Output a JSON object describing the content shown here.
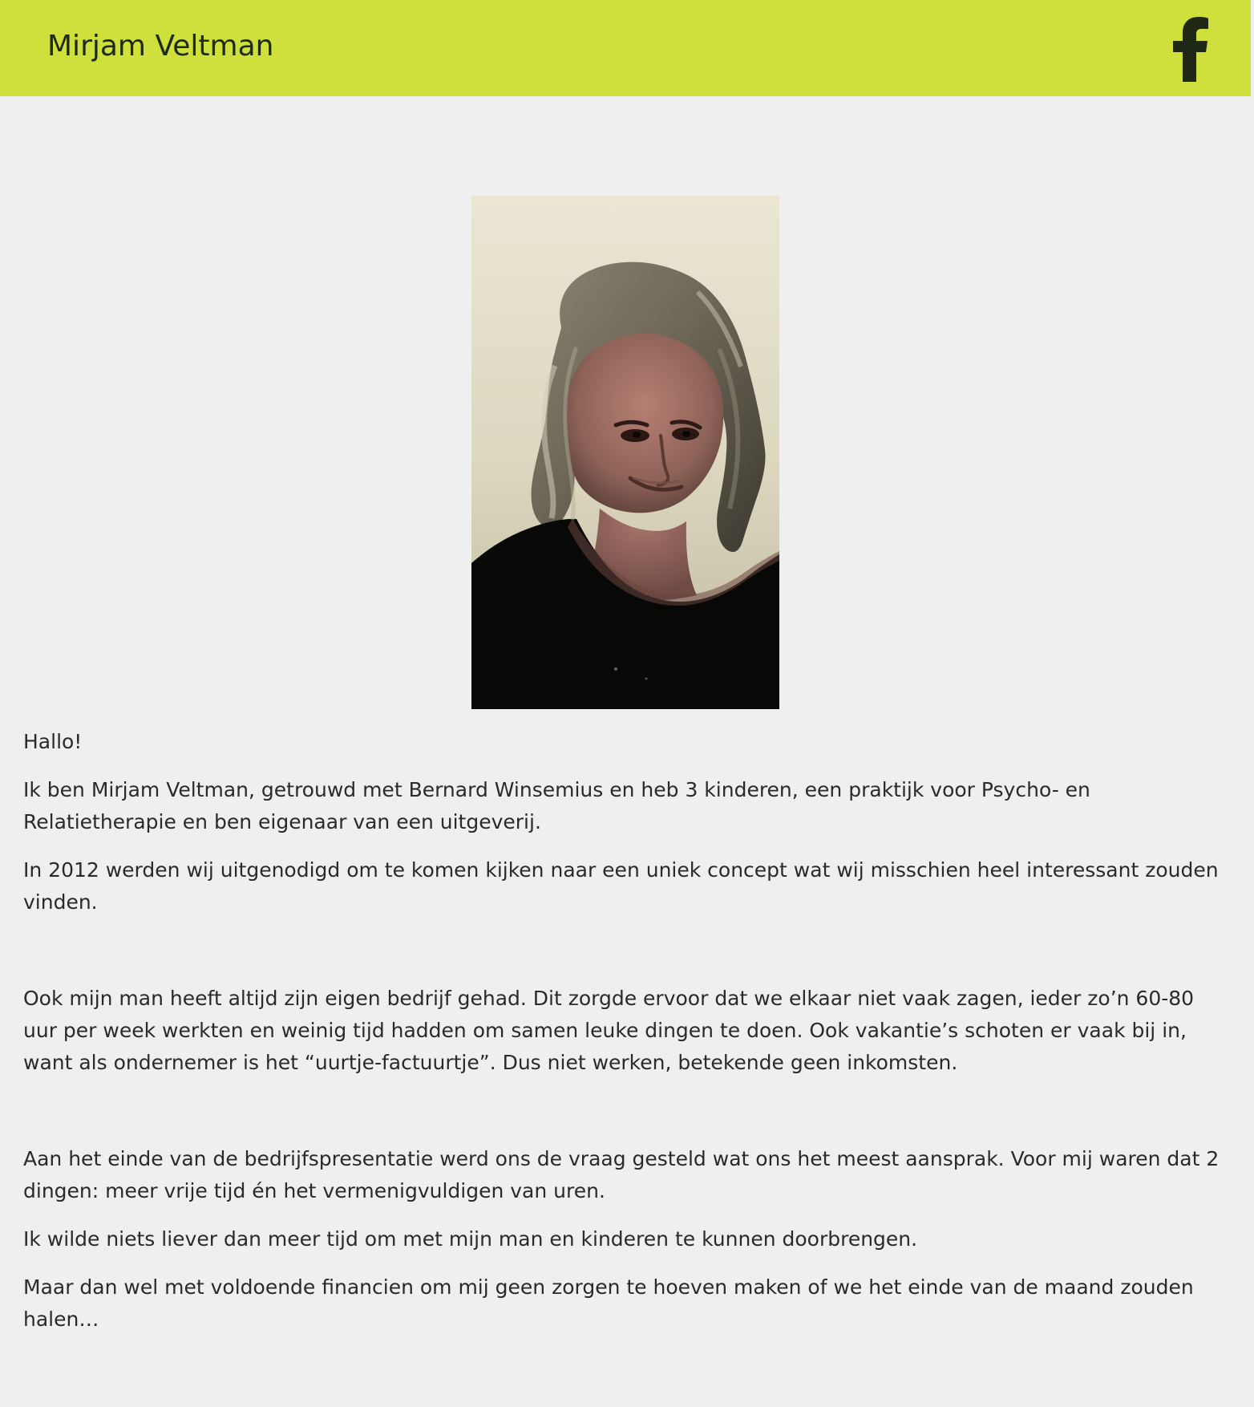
{
  "header": {
    "site_title": "Mirjam Veltman",
    "background_color": "#cfdf3b",
    "facebook_icon": "facebook-icon"
  },
  "portrait": {
    "image": "portrait-photo"
  },
  "content": {
    "greeting": "Hallo!",
    "paragraphs": [
      "Ik ben Mirjam Veltman, getrouwd met Bernard Winsemius en heb 3 kinderen, een praktijk voor Psycho- en Relatietherapie en ben eigenaar van een uitgeverij.",
      "In 2012 werden wij uitgenodigd om te komen kijken naar een uniek concept wat wij misschien heel interessant zouden vinden.",
      "Ook mijn man heeft altijd zijn eigen bedrijf gehad. Dit zorgde ervoor dat we elkaar niet vaak zagen, ieder zo’n 60-80 uur per week werkten en weinig tijd hadden om samen leuke dingen te doen. Ook vakantie’s schoten er vaak bij in, want als ondernemer is het “uurtje-factuurtje”. Dus niet werken, betekende geen inkomsten.",
      "Aan het einde van de bedrijfspresentatie werd ons de vraag gesteld wat ons het meest aansprak. Voor mij waren dat 2 dingen: meer vrije tijd én het vermenigvuldigen van uren.",
      "Ik wilde niets liever dan meer tijd om met mijn man en kinderen te kunnen doorbrengen.",
      "Maar dan wel met voldoende financien om mij geen zorgen te hoeven maken of we het einde van de maand zouden halen…"
    ]
  }
}
